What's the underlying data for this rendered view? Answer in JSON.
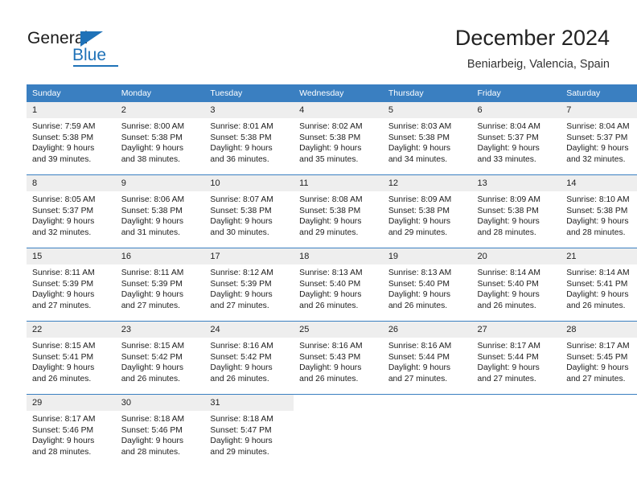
{
  "brand": {
    "name_top": "General",
    "name_bottom": "Blue",
    "accent_color": "#1f72b8"
  },
  "header": {
    "title": "December 2024",
    "subtitle": "Beniarbeig, Valencia, Spain"
  },
  "calendar": {
    "header_bg": "#3a7fc1",
    "daynum_bg": "#eeeeee",
    "weekday_headers": [
      "Sunday",
      "Monday",
      "Tuesday",
      "Wednesday",
      "Thursday",
      "Friday",
      "Saturday"
    ],
    "weeks": [
      [
        {
          "day": "1",
          "sunrise": "Sunrise: 7:59 AM",
          "sunset": "Sunset: 5:38 PM",
          "daylight_line1": "Daylight: 9 hours",
          "daylight_line2": "and 39 minutes."
        },
        {
          "day": "2",
          "sunrise": "Sunrise: 8:00 AM",
          "sunset": "Sunset: 5:38 PM",
          "daylight_line1": "Daylight: 9 hours",
          "daylight_line2": "and 38 minutes."
        },
        {
          "day": "3",
          "sunrise": "Sunrise: 8:01 AM",
          "sunset": "Sunset: 5:38 PM",
          "daylight_line1": "Daylight: 9 hours",
          "daylight_line2": "and 36 minutes."
        },
        {
          "day": "4",
          "sunrise": "Sunrise: 8:02 AM",
          "sunset": "Sunset: 5:38 PM",
          "daylight_line1": "Daylight: 9 hours",
          "daylight_line2": "and 35 minutes."
        },
        {
          "day": "5",
          "sunrise": "Sunrise: 8:03 AM",
          "sunset": "Sunset: 5:38 PM",
          "daylight_line1": "Daylight: 9 hours",
          "daylight_line2": "and 34 minutes."
        },
        {
          "day": "6",
          "sunrise": "Sunrise: 8:04 AM",
          "sunset": "Sunset: 5:37 PM",
          "daylight_line1": "Daylight: 9 hours",
          "daylight_line2": "and 33 minutes."
        },
        {
          "day": "7",
          "sunrise": "Sunrise: 8:04 AM",
          "sunset": "Sunset: 5:37 PM",
          "daylight_line1": "Daylight: 9 hours",
          "daylight_line2": "and 32 minutes."
        }
      ],
      [
        {
          "day": "8",
          "sunrise": "Sunrise: 8:05 AM",
          "sunset": "Sunset: 5:37 PM",
          "daylight_line1": "Daylight: 9 hours",
          "daylight_line2": "and 32 minutes."
        },
        {
          "day": "9",
          "sunrise": "Sunrise: 8:06 AM",
          "sunset": "Sunset: 5:38 PM",
          "daylight_line1": "Daylight: 9 hours",
          "daylight_line2": "and 31 minutes."
        },
        {
          "day": "10",
          "sunrise": "Sunrise: 8:07 AM",
          "sunset": "Sunset: 5:38 PM",
          "daylight_line1": "Daylight: 9 hours",
          "daylight_line2": "and 30 minutes."
        },
        {
          "day": "11",
          "sunrise": "Sunrise: 8:08 AM",
          "sunset": "Sunset: 5:38 PM",
          "daylight_line1": "Daylight: 9 hours",
          "daylight_line2": "and 29 minutes."
        },
        {
          "day": "12",
          "sunrise": "Sunrise: 8:09 AM",
          "sunset": "Sunset: 5:38 PM",
          "daylight_line1": "Daylight: 9 hours",
          "daylight_line2": "and 29 minutes."
        },
        {
          "day": "13",
          "sunrise": "Sunrise: 8:09 AM",
          "sunset": "Sunset: 5:38 PM",
          "daylight_line1": "Daylight: 9 hours",
          "daylight_line2": "and 28 minutes."
        },
        {
          "day": "14",
          "sunrise": "Sunrise: 8:10 AM",
          "sunset": "Sunset: 5:38 PM",
          "daylight_line1": "Daylight: 9 hours",
          "daylight_line2": "and 28 minutes."
        }
      ],
      [
        {
          "day": "15",
          "sunrise": "Sunrise: 8:11 AM",
          "sunset": "Sunset: 5:39 PM",
          "daylight_line1": "Daylight: 9 hours",
          "daylight_line2": "and 27 minutes."
        },
        {
          "day": "16",
          "sunrise": "Sunrise: 8:11 AM",
          "sunset": "Sunset: 5:39 PM",
          "daylight_line1": "Daylight: 9 hours",
          "daylight_line2": "and 27 minutes."
        },
        {
          "day": "17",
          "sunrise": "Sunrise: 8:12 AM",
          "sunset": "Sunset: 5:39 PM",
          "daylight_line1": "Daylight: 9 hours",
          "daylight_line2": "and 27 minutes."
        },
        {
          "day": "18",
          "sunrise": "Sunrise: 8:13 AM",
          "sunset": "Sunset: 5:40 PM",
          "daylight_line1": "Daylight: 9 hours",
          "daylight_line2": "and 26 minutes."
        },
        {
          "day": "19",
          "sunrise": "Sunrise: 8:13 AM",
          "sunset": "Sunset: 5:40 PM",
          "daylight_line1": "Daylight: 9 hours",
          "daylight_line2": "and 26 minutes."
        },
        {
          "day": "20",
          "sunrise": "Sunrise: 8:14 AM",
          "sunset": "Sunset: 5:40 PM",
          "daylight_line1": "Daylight: 9 hours",
          "daylight_line2": "and 26 minutes."
        },
        {
          "day": "21",
          "sunrise": "Sunrise: 8:14 AM",
          "sunset": "Sunset: 5:41 PM",
          "daylight_line1": "Daylight: 9 hours",
          "daylight_line2": "and 26 minutes."
        }
      ],
      [
        {
          "day": "22",
          "sunrise": "Sunrise: 8:15 AM",
          "sunset": "Sunset: 5:41 PM",
          "daylight_line1": "Daylight: 9 hours",
          "daylight_line2": "and 26 minutes."
        },
        {
          "day": "23",
          "sunrise": "Sunrise: 8:15 AM",
          "sunset": "Sunset: 5:42 PM",
          "daylight_line1": "Daylight: 9 hours",
          "daylight_line2": "and 26 minutes."
        },
        {
          "day": "24",
          "sunrise": "Sunrise: 8:16 AM",
          "sunset": "Sunset: 5:42 PM",
          "daylight_line1": "Daylight: 9 hours",
          "daylight_line2": "and 26 minutes."
        },
        {
          "day": "25",
          "sunrise": "Sunrise: 8:16 AM",
          "sunset": "Sunset: 5:43 PM",
          "daylight_line1": "Daylight: 9 hours",
          "daylight_line2": "and 26 minutes."
        },
        {
          "day": "26",
          "sunrise": "Sunrise: 8:16 AM",
          "sunset": "Sunset: 5:44 PM",
          "daylight_line1": "Daylight: 9 hours",
          "daylight_line2": "and 27 minutes."
        },
        {
          "day": "27",
          "sunrise": "Sunrise: 8:17 AM",
          "sunset": "Sunset: 5:44 PM",
          "daylight_line1": "Daylight: 9 hours",
          "daylight_line2": "and 27 minutes."
        },
        {
          "day": "28",
          "sunrise": "Sunrise: 8:17 AM",
          "sunset": "Sunset: 5:45 PM",
          "daylight_line1": "Daylight: 9 hours",
          "daylight_line2": "and 27 minutes."
        }
      ],
      [
        {
          "day": "29",
          "sunrise": "Sunrise: 8:17 AM",
          "sunset": "Sunset: 5:46 PM",
          "daylight_line1": "Daylight: 9 hours",
          "daylight_line2": "and 28 minutes."
        },
        {
          "day": "30",
          "sunrise": "Sunrise: 8:18 AM",
          "sunset": "Sunset: 5:46 PM",
          "daylight_line1": "Daylight: 9 hours",
          "daylight_line2": "and 28 minutes."
        },
        {
          "day": "31",
          "sunrise": "Sunrise: 8:18 AM",
          "sunset": "Sunset: 5:47 PM",
          "daylight_line1": "Daylight: 9 hours",
          "daylight_line2": "and 29 minutes."
        },
        {
          "day": "",
          "sunrise": "",
          "sunset": "",
          "daylight_line1": "",
          "daylight_line2": ""
        },
        {
          "day": "",
          "sunrise": "",
          "sunset": "",
          "daylight_line1": "",
          "daylight_line2": ""
        },
        {
          "day": "",
          "sunrise": "",
          "sunset": "",
          "daylight_line1": "",
          "daylight_line2": ""
        },
        {
          "day": "",
          "sunrise": "",
          "sunset": "",
          "daylight_line1": "",
          "daylight_line2": ""
        }
      ]
    ]
  }
}
